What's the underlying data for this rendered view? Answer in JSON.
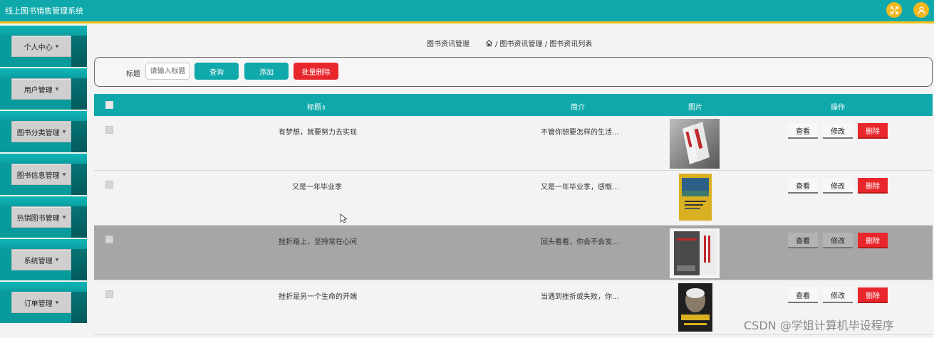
{
  "app": {
    "title": "线上图书销售管理系统"
  },
  "header": {
    "fullscreen_icon": "fullscreen-icon",
    "user_icon": "user-icon",
    "accent": "#f4b81f"
  },
  "sidebar": {
    "items": [
      {
        "label": "个人中心"
      },
      {
        "label": "用户管理"
      },
      {
        "label": "图书分类管理"
      },
      {
        "label": "图书信息管理"
      },
      {
        "label": "热销图书管理"
      },
      {
        "label": "系统管理"
      },
      {
        "label": "订单管理"
      }
    ]
  },
  "breadcrumb": {
    "current_section": "图书资讯管理",
    "path": "/ 图书资讯管理 / 图书资讯列表"
  },
  "search": {
    "label": "标题",
    "placeholder": "请输入标题",
    "value": "",
    "query_label": "查询",
    "add_label": "添加",
    "batch_delete_label": "批量删除"
  },
  "table": {
    "columns": {
      "title": "标题",
      "summary": "简介",
      "image": "图片",
      "actions": "操作"
    },
    "sort_icon": "sort-icon",
    "action_labels": {
      "view": "查看",
      "edit": "修改",
      "delete": "删除"
    },
    "rows": [
      {
        "title": "有梦想，就要努力去实现",
        "summary": "不管你想要怎样的生活..."
      },
      {
        "title": "又是一年毕业季",
        "summary": "又是一年毕业季，感慨..."
      },
      {
        "title": "挫折路上，坚持常在心间",
        "summary": "回头看看，你会不会发..."
      },
      {
        "title": "挫折是另一个生命的开端",
        "summary": "当遇到挫折或失败，你..."
      }
    ]
  },
  "colors": {
    "primary": "#10a9ab",
    "danger": "#e8262c",
    "header_border": "#f0c419"
  },
  "watermark": "CSDN @学姐计算机毕设程序"
}
